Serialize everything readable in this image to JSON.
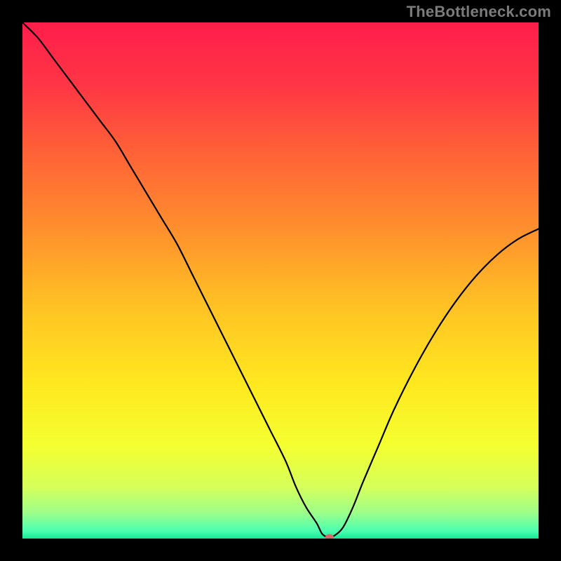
{
  "watermark": "TheBottleneck.com",
  "chart_data": {
    "type": "line",
    "title": "",
    "xlabel": "",
    "ylabel": "",
    "xlim": [
      0,
      100
    ],
    "ylim": [
      0,
      100
    ],
    "legend": false,
    "grid": false,
    "background_gradient": {
      "stops": [
        {
          "pos": 0.0,
          "color": "#ff1e4b"
        },
        {
          "pos": 0.12,
          "color": "#ff3545"
        },
        {
          "pos": 0.25,
          "color": "#ff6137"
        },
        {
          "pos": 0.4,
          "color": "#ff8f2d"
        },
        {
          "pos": 0.55,
          "color": "#ffc224"
        },
        {
          "pos": 0.7,
          "color": "#ffe81f"
        },
        {
          "pos": 0.82,
          "color": "#f4ff30"
        },
        {
          "pos": 0.9,
          "color": "#d6ff5a"
        },
        {
          "pos": 0.95,
          "color": "#9dff8a"
        },
        {
          "pos": 0.985,
          "color": "#4bffb0"
        },
        {
          "pos": 1.0,
          "color": "#17e896"
        }
      ]
    },
    "series": [
      {
        "name": "bottleneck-curve",
        "color": "#000000",
        "width": 2.2,
        "x": [
          0,
          3,
          6,
          9,
          12,
          15,
          18,
          21,
          24,
          27,
          30,
          33,
          36,
          39,
          42,
          45,
          48,
          51,
          53,
          55,
          57,
          58,
          59,
          60,
          62,
          64,
          66,
          69,
          72,
          76,
          80,
          84,
          88,
          92,
          96,
          100
        ],
        "y": [
          100,
          97,
          93,
          89,
          85,
          81,
          77,
          72,
          67,
          62,
          57,
          51,
          45,
          39,
          33,
          27,
          21,
          15,
          10,
          6,
          3,
          1,
          0.3,
          0.3,
          2,
          6,
          11,
          18,
          25,
          33,
          40,
          46,
          51,
          55,
          58,
          60
        ]
      }
    ],
    "marker": {
      "name": "optimum-marker",
      "x": 59.5,
      "y": 0.3,
      "rx": 6,
      "ry": 4,
      "color": "#d66a6a"
    }
  }
}
